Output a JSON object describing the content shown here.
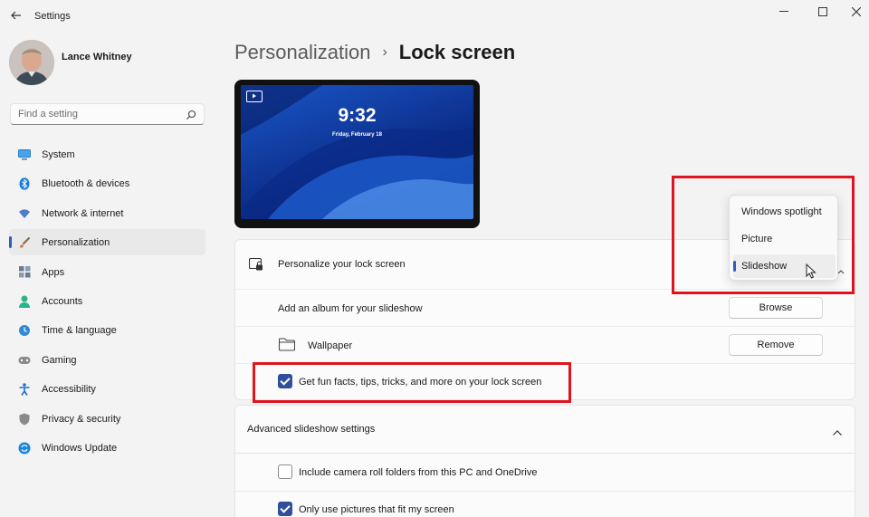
{
  "window": {
    "title": "Settings"
  },
  "user": {
    "name": "Lance Whitney"
  },
  "search": {
    "placeholder": "Find a setting"
  },
  "nav": {
    "items": [
      {
        "label": "System",
        "icon": "monitor-icon",
        "color": "#3a8fd8"
      },
      {
        "label": "Bluetooth & devices",
        "icon": "bluetooth-icon",
        "color": "#1b7dd8"
      },
      {
        "label": "Network & internet",
        "icon": "wifi-icon",
        "color": "#4a7ec9"
      },
      {
        "label": "Personalization",
        "icon": "brush-icon",
        "color": "#d77b3a",
        "active": true
      },
      {
        "label": "Apps",
        "icon": "apps-icon",
        "color": "#6b7a8f"
      },
      {
        "label": "Accounts",
        "icon": "person-icon",
        "color": "#2bb38b"
      },
      {
        "label": "Time & language",
        "icon": "globe-clock-icon",
        "color": "#2f8bd6"
      },
      {
        "label": "Gaming",
        "icon": "gamepad-icon",
        "color": "#7a7a7a"
      },
      {
        "label": "Accessibility",
        "icon": "accessibility-icon",
        "color": "#1f6fcf"
      },
      {
        "label": "Privacy & security",
        "icon": "shield-icon",
        "color": "#8a8a8a"
      },
      {
        "label": "Windows Update",
        "icon": "update-icon",
        "color": "#1b86d8"
      }
    ]
  },
  "breadcrumb": {
    "parent": "Personalization",
    "separator": "›",
    "current": "Lock screen"
  },
  "preview": {
    "time": "9:32",
    "date": "Friday, February 18"
  },
  "lock_screen": {
    "personalize_label": "Personalize your lock screen",
    "album_label": "Add an album for your slideshow",
    "browse_label": "Browse",
    "wallpaper_label": "Wallpaper",
    "remove_label": "Remove",
    "fun_facts_label": "Get fun facts, tips, tricks, and more on your lock screen",
    "fun_facts_checked": true
  },
  "dropdown": {
    "options": [
      "Windows spotlight",
      "Picture",
      "Slideshow"
    ],
    "selected": "Slideshow"
  },
  "advanced": {
    "title": "Advanced slideshow settings",
    "camera_roll_label": "Include camera roll folders from this PC and OneDrive",
    "camera_roll_checked": false,
    "fit_screen_label": "Only use pictures that fit my screen",
    "fit_screen_checked": true
  },
  "colors": {
    "accent": "#2f5fb6",
    "checkbox_on": "#2f4f9e",
    "highlight_box": "#e0141e"
  }
}
